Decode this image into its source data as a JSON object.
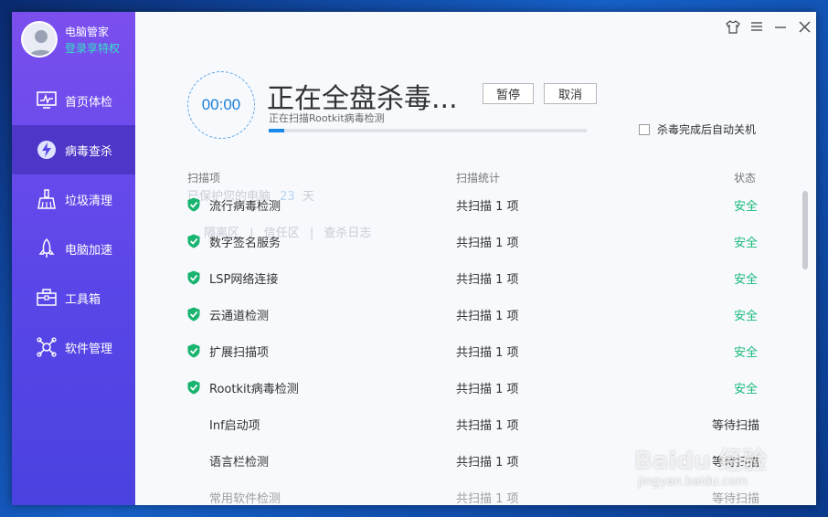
{
  "profile": {
    "name": "电脑管家",
    "subtitle": "登录享特权"
  },
  "nav": [
    {
      "label": "首页体检",
      "icon": "monitor-icon"
    },
    {
      "label": "病毒查杀",
      "icon": "lightning-shield-icon"
    },
    {
      "label": "垃圾清理",
      "icon": "broom-icon"
    },
    {
      "label": "电脑加速",
      "icon": "rocket-icon"
    },
    {
      "label": "工具箱",
      "icon": "toolbox-icon"
    },
    {
      "label": "软件管理",
      "icon": "software-icon"
    }
  ],
  "scan": {
    "timer": "00:00",
    "title": "正在全盘杀毒...",
    "pause_label": "暂停",
    "cancel_label": "取消",
    "subtitle": "正在扫描Rootkit病毒检测",
    "progress": 0.05,
    "auto_shutdown_label": "杀毒完成后自动关机"
  },
  "table": {
    "headers": {
      "item": "扫描项",
      "stats": "扫描统计",
      "status": "状态"
    },
    "rows": [
      {
        "name": "流行病毒检测",
        "stat": "共扫描 1 项",
        "status": "安全",
        "state": "safe"
      },
      {
        "name": "数字签名服务",
        "stat": "共扫描 1 项",
        "status": "安全",
        "state": "safe"
      },
      {
        "name": "LSP网络连接",
        "stat": "共扫描 1 项",
        "status": "安全",
        "state": "safe"
      },
      {
        "name": "云通道检测",
        "stat": "共扫描 1 项",
        "status": "安全",
        "state": "safe"
      },
      {
        "name": "扩展扫描项",
        "stat": "共扫描 1 项",
        "status": "安全",
        "state": "safe"
      },
      {
        "name": "Rootkit病毒检测",
        "stat": "共扫描 1 项",
        "status": "安全",
        "state": "safe"
      },
      {
        "name": "Inf启动项",
        "stat": "共扫描 1 项",
        "status": "等待扫描",
        "state": "wait"
      },
      {
        "name": "语言栏检测",
        "stat": "共扫描 1 项",
        "status": "等待扫描",
        "state": "wait"
      },
      {
        "name": "常用软件检测",
        "stat": "共扫描 1 项",
        "status": "等待扫描",
        "state": "wait"
      }
    ]
  },
  "ghost": {
    "protect_days_prefix": "已保护您的电脑",
    "protect_days_value": "23",
    "protect_days_unit": "天",
    "links": [
      "隔离区",
      "信任区",
      "查杀日志"
    ]
  },
  "watermark": {
    "main": "Baidu 经验",
    "sub": "jingyan.baidu.com"
  },
  "colors": {
    "accent": "#1a7fd8",
    "safe": "#18b97a",
    "sidebar_top": "#7b4fee",
    "sidebar_bottom": "#4a42e0"
  }
}
